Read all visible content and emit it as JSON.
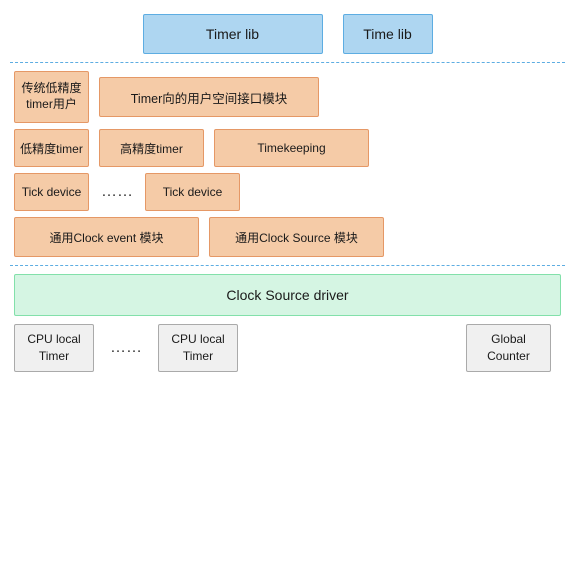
{
  "row1": {
    "timer_lib": "Timer lib",
    "time_lib": "Time lib"
  },
  "row2": {
    "legacy_timer": "传统低精度\ntimer用户",
    "timer_user_space": "Timer向的用户空间接口模块"
  },
  "row3": {
    "low_res": "低精度timer",
    "high_res": "高精度timer",
    "timekeeping": "Timekeeping"
  },
  "row4": {
    "tick_dev1": "Tick device",
    "dots": "……",
    "tick_dev2": "Tick device"
  },
  "row5": {
    "clock_event": "通用Clock event 模块",
    "clock_source_mod": "通用Clock Source 模块"
  },
  "row6": {
    "clock_source_driver": "Clock Source driver"
  },
  "row7": {
    "cpu_timer1_line1": "CPU local",
    "cpu_timer1_line2": "Timer",
    "dots": "……",
    "cpu_timer2_line1": "CPU local",
    "cpu_timer2_line2": "Timer",
    "global_counter_line1": "Global",
    "global_counter_line2": "Counter"
  }
}
